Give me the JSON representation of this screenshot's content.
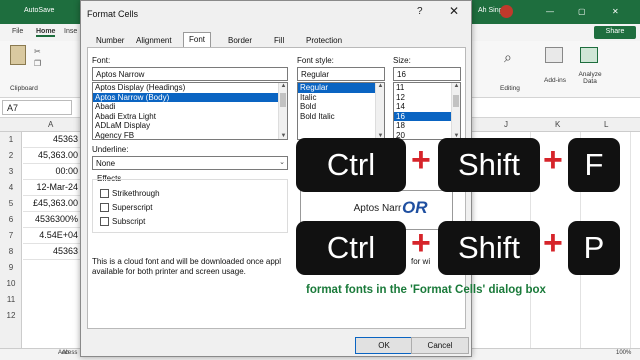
{
  "excel": {
    "autosave_label": "AutoSave",
    "user_name": "Ah Sing",
    "window_buttons": [
      "—",
      "▢",
      "✕"
    ],
    "tabs": [
      "File",
      "Home",
      "Inse"
    ],
    "share_label": "Share",
    "clipboard_label": "Clipboard",
    "editing_label": "Editing",
    "add_ins_label": "Add-ins",
    "analyze_data_label": "Analyze Data",
    "name_box": "A7",
    "columns_left": [
      "A"
    ],
    "columns_right": [
      "J",
      "K",
      "L"
    ],
    "rows": [
      "1",
      "2",
      "3",
      "4",
      "5",
      "6",
      "7",
      "8",
      "9",
      "10",
      "11",
      "12"
    ],
    "cells_A": [
      "45363",
      "45,363.00",
      "00:00",
      "12-Mar-24",
      "£45,363.00",
      "4536300%",
      "4.54E+04",
      "45363"
    ],
    "sheet_tab": "Ah",
    "status_access": "Access",
    "zoom_level": "100%"
  },
  "dialog": {
    "title": "Format Cells",
    "help_glyph": "?",
    "close_glyph": "✕",
    "tabs": [
      "Number",
      "Alignment",
      "Font",
      "Border",
      "Fill",
      "Protection"
    ],
    "active_tab": "Font",
    "font_label": "Font:",
    "font_value": "Aptos Narrow",
    "font_list": [
      "Aptos Display (Headings)",
      "Aptos Narrow (Body)",
      "Abadi",
      "Abadi Extra Light",
      "ADLaM Display",
      "Agency FB"
    ],
    "font_selected_index": 1,
    "style_label": "Font style:",
    "style_value": "Regular",
    "style_list": [
      "Regular",
      "Italic",
      "Bold",
      "Bold Italic"
    ],
    "style_selected_index": 0,
    "size_label": "Size:",
    "size_value": "16",
    "size_list": [
      "11",
      "12",
      "14",
      "16",
      "18",
      "20"
    ],
    "size_selected_index": 3,
    "underline_label": "Underline:",
    "underline_value": "None",
    "color_label_partial": "C",
    "effects_label": "Effects",
    "effects": [
      "Strikethrough",
      "Superscript",
      "Subscript"
    ],
    "preview_text": "Aptos Narr",
    "note_line1": "This is a cloud font and will be downloaded once appl",
    "note_line2": "available for both printer and screen usage.",
    "note_tail": "for wi",
    "ok_label": "OK",
    "cancel_label": "Cancel"
  },
  "overlay": {
    "row1": [
      "Ctrl",
      "Shift",
      "F"
    ],
    "row2": [
      "Ctrl",
      "Shift",
      "P"
    ],
    "plus": "+",
    "or_label": "OR",
    "caption": "format fonts in the 'Format Cells' dialog box",
    "plus_color": "#d6242a",
    "caption_color": "#1a7a3a",
    "or_color": "#1f4fa0"
  }
}
